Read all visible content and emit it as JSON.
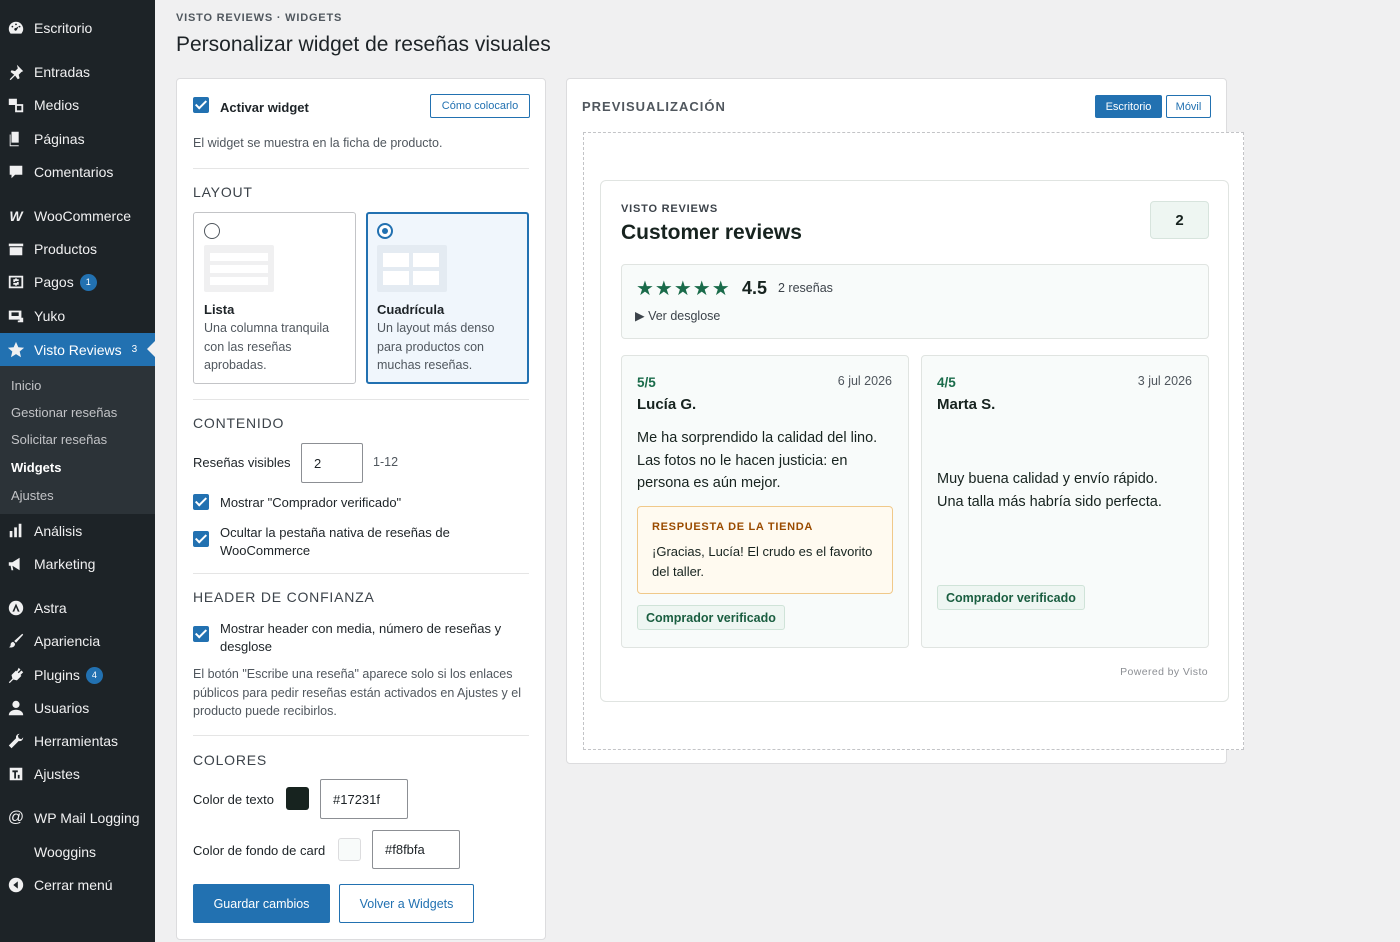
{
  "sidebar": {
    "menu": [
      {
        "label": "Escritorio",
        "icon": "dashboard-icon"
      },
      {
        "label": "Entradas",
        "icon": "pin-icon"
      },
      {
        "label": "Medios",
        "icon": "media-icon"
      },
      {
        "label": "Páginas",
        "icon": "pages-icon"
      },
      {
        "label": "Comentarios",
        "icon": "comment-icon"
      },
      {
        "label": "WooCommerce",
        "icon": "woo-icon"
      },
      {
        "label": "Productos",
        "icon": "products-icon"
      },
      {
        "label": "Pagos",
        "icon": "payments-icon",
        "badge": "1"
      },
      {
        "label": "Yuko",
        "icon": "yuko-icon"
      },
      {
        "label": "Visto Reviews",
        "icon": "star-icon",
        "badge": "3"
      },
      {
        "label": "Análisis",
        "icon": "analytics-icon"
      },
      {
        "label": "Marketing",
        "icon": "megaphone-icon"
      },
      {
        "label": "Astra",
        "icon": "astra-icon"
      },
      {
        "label": "Apariencia",
        "icon": "brush-icon"
      },
      {
        "label": "Plugins",
        "icon": "plugin-icon",
        "badge": "4"
      },
      {
        "label": "Usuarios",
        "icon": "user-icon"
      },
      {
        "label": "Herramientas",
        "icon": "wrench-icon"
      },
      {
        "label": "Ajustes",
        "icon": "settings-icon"
      },
      {
        "label": "WP Mail Logging",
        "icon": "at-icon"
      },
      {
        "label": "Wooggins"
      },
      {
        "label": "Cerrar menú",
        "icon": "collapse-icon"
      }
    ],
    "submenu": [
      "Inicio",
      "Gestionar reseñas",
      "Solicitar reseñas",
      "Widgets",
      "Ajustes"
    ]
  },
  "header": {
    "eyebrow": "VISTO REVIEWS · WIDGETS",
    "title": "Personalizar widget de reseñas visuales"
  },
  "settings": {
    "activate_label": "Activar widget",
    "how_button": "Cómo colocarlo",
    "activate_help": "El widget se muestra en la ficha de producto.",
    "layout_heading": "LAYOUT",
    "layout_options": [
      {
        "title": "Lista",
        "desc": "Una columna tranquila con las reseñas aprobadas."
      },
      {
        "title": "Cuadrícula",
        "desc": "Un layout más denso para productos con muchas reseñas."
      }
    ],
    "content_heading": "CONTENIDO",
    "visible_label": "Reseñas visibles",
    "visible_value": "2",
    "visible_range": "1-12",
    "show_verified": "Mostrar \"Comprador verificado\"",
    "hide_native": "Ocultar la pestaña nativa de reseñas de WooCommerce",
    "trust_heading": "HEADER DE CONFIANZA",
    "trust_option": "Mostrar header con media, número de reseñas y desglose",
    "trust_help": "El botón \"Escribe una reseña\" aparece solo si los enlaces públicos para pedir reseñas están activados en Ajustes y el producto puede recibirlos.",
    "colors_heading": "COLORES",
    "text_color_label": "Color de texto",
    "text_color": "#17231f",
    "card_bg_label": "Color de fondo de card",
    "card_bg_color": "#f8fbfa",
    "save_button": "Guardar cambios",
    "back_button": "Volver a Widgets"
  },
  "preview": {
    "heading": "PREVISUALIZACIÓN",
    "desktop": "Escritorio",
    "mobile": "Móvil",
    "widget": {
      "eyebrow": "VISTO REVIEWS",
      "title": "Customer reviews",
      "count": "2",
      "stars": "★★★★★",
      "average": "4.5",
      "review_count": "2 reseñas",
      "breakdown": "▶ Ver desglose",
      "reviews": [
        {
          "score": "5/5",
          "date": "6 jul 2026",
          "name": "Lucía G.",
          "text": "Me ha sorprendido la calidad del lino. Las fotos no le hacen justicia: en persona es aún mejor.",
          "reply_heading": "RESPUESTA DE LA TIENDA",
          "reply": "¡Gracias, Lucía! El crudo es el favorito del taller.",
          "badge": "Comprador verificado"
        },
        {
          "score": "4/5",
          "date": "3 jul 2026",
          "name": "Marta S.",
          "text": "Muy buena calidad y envío rápido. Una talla más habría sido perfecta.",
          "badge": "Comprador verificado"
        }
      ],
      "powered": "Powered by Visto"
    }
  },
  "colors": {
    "accent": "#2271b1",
    "sidebar_bg": "#1d2327",
    "brand_green": "#1a6b4a"
  }
}
